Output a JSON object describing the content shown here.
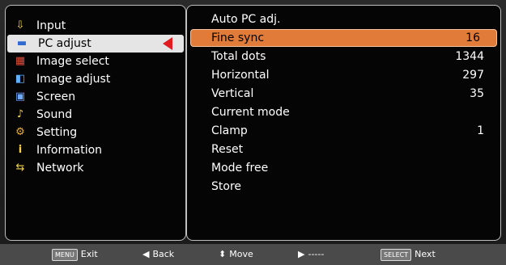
{
  "sidebar": {
    "items": [
      {
        "label": "Input",
        "icon": "input-icon",
        "glyph": "⇩"
      },
      {
        "label": "PC adjust",
        "icon": "pc-adjust-icon",
        "glyph": "▬"
      },
      {
        "label": "Image select",
        "icon": "image-select-icon",
        "glyph": "▦"
      },
      {
        "label": "Image adjust",
        "icon": "image-adjust-icon",
        "glyph": "◧"
      },
      {
        "label": "Screen",
        "icon": "screen-icon",
        "glyph": "▣"
      },
      {
        "label": "Sound",
        "icon": "sound-icon",
        "glyph": "♪"
      },
      {
        "label": "Setting",
        "icon": "setting-icon",
        "glyph": "⚙"
      },
      {
        "label": "Information",
        "icon": "information-icon",
        "glyph": "i"
      },
      {
        "label": "Network",
        "icon": "network-icon",
        "glyph": "⇆"
      }
    ]
  },
  "main": {
    "items": [
      {
        "label": "Auto PC adj.",
        "value": ""
      },
      {
        "label": "Fine sync",
        "value": "16"
      },
      {
        "label": "Total dots",
        "value": "1344"
      },
      {
        "label": "Horizontal",
        "value": "297"
      },
      {
        "label": "Vertical",
        "value": "35"
      },
      {
        "label": "Current mode",
        "value": ""
      },
      {
        "label": "Clamp",
        "value": "1"
      },
      {
        "label": "Reset",
        "value": ""
      },
      {
        "label": "Mode free",
        "value": ""
      },
      {
        "label": "Store",
        "value": ""
      }
    ]
  },
  "footer": {
    "exit_key": "MENU",
    "exit_label": "Exit",
    "back_label": "Back",
    "move_label": "Move",
    "dash_label": "-----",
    "select_key": "SELECT",
    "next_label": "Next"
  },
  "colors": {
    "selection_orange": "#e07b39",
    "arrow_red": "#e21b23"
  }
}
